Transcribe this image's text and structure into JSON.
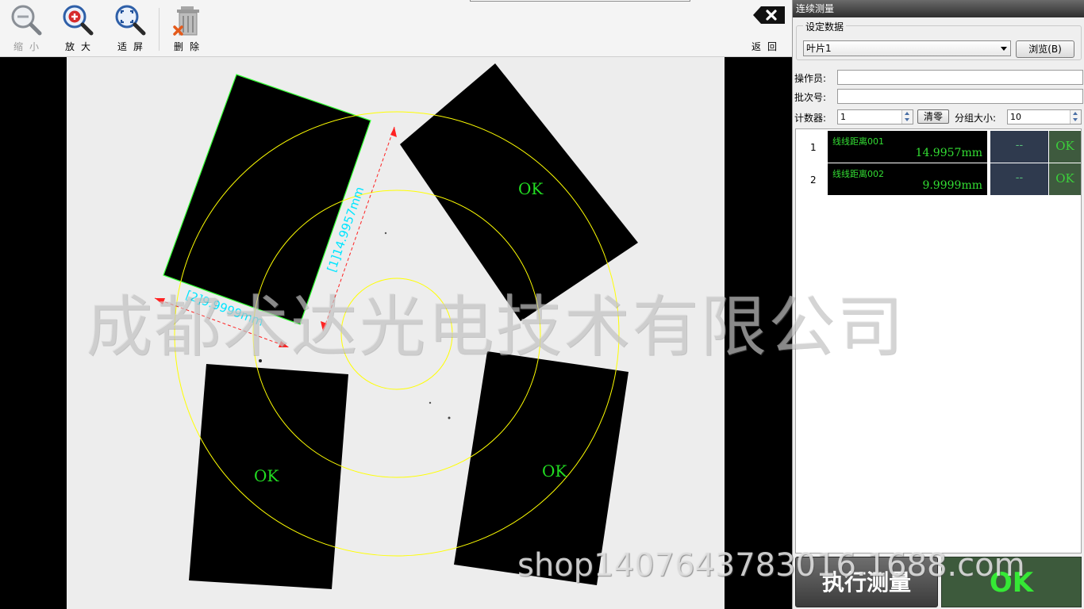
{
  "toolbar": {
    "zoom_out_label": "缩小",
    "zoom_in_label": "放大",
    "fit_label": "适屏",
    "delete_label": "删除",
    "back_label": "返回"
  },
  "viewer": {
    "labels": {
      "measure1": "[1]14.9957mm",
      "measure2": "[2]9.9999mm",
      "ok_top_right": "OK",
      "ok_bottom_left": "OK",
      "ok_bottom_right": "OK"
    },
    "colors": {
      "circle": "#ffff00",
      "outline": "#33ff33",
      "dimension_line": "#ff2222",
      "dimension_text": "#00e5ff",
      "ok_text": "#22dd22"
    }
  },
  "panel": {
    "title": "连续测量",
    "setting_group": "设定数据",
    "preset_value": "叶片1",
    "browse_label": "浏览(B)",
    "operator_label": "操作员:",
    "operator_value": "",
    "batch_label": "批次号:",
    "batch_value": "",
    "counter_label": "计数器:",
    "counter_value": "1",
    "clear_label": "清零",
    "group_size_label": "分组大小:",
    "group_size_value": "10",
    "results": [
      {
        "index": "1",
        "name": "线线距离001",
        "value": "14.9957mm",
        "dash": "--",
        "status": "OK"
      },
      {
        "index": "2",
        "name": "线线距离002",
        "value": "9.9999mm",
        "dash": "--",
        "status": "OK"
      }
    ],
    "run_label": "执行测量",
    "status_label": "OK"
  },
  "watermarks": {
    "company": "成都术达光电技术有限公司",
    "shop": "shop1407643783016.1688.com"
  },
  "icons": [
    "zoom-out-icon",
    "zoom-in-icon",
    "fit-screen-icon",
    "delete-icon",
    "back-icon"
  ]
}
